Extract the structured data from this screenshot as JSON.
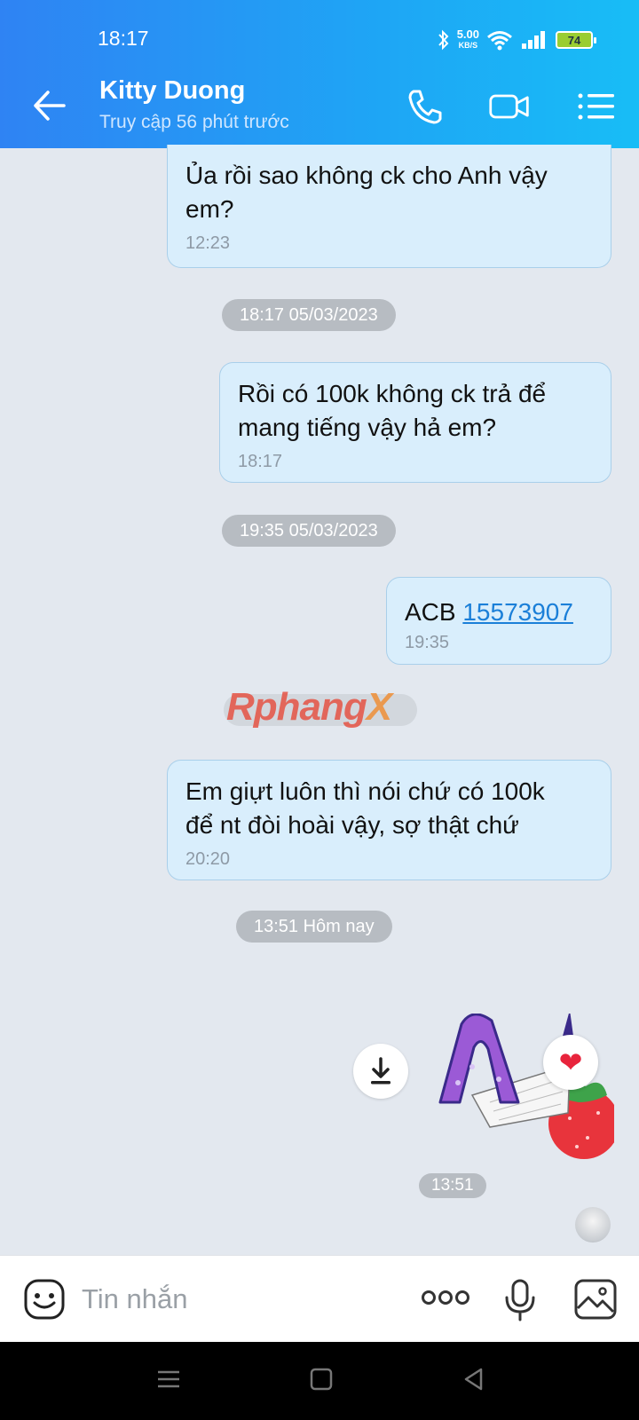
{
  "status_bar": {
    "time": "18:17",
    "net_speed": "5.00",
    "net_unit": "KB/S",
    "battery": "74"
  },
  "header": {
    "title": "Kitty Duong",
    "subtitle": "Truy cập 56 phút trước"
  },
  "messages": [
    {
      "text": "Ủa rồi sao không ck cho Anh vậy\nem?",
      "time": "12:23"
    },
    {
      "date": "18:17 05/03/2023"
    },
    {
      "text": "Rồi có 100k không ck trả để\nmang tiếng vậy hả em?",
      "time": "18:17"
    },
    {
      "date": "19:35 05/03/2023"
    },
    {
      "prefix": "ACB ",
      "link": "15573907",
      "time": "19:35"
    },
    {
      "text": "Em giựt luôn thì nói chứ có 100k\nđể nt đòi hoài vậy, sợ thật chứ",
      "time": "20:20"
    },
    {
      "date": "13:51 Hôm nay"
    },
    {
      "sticker_time": "13:51"
    }
  ],
  "watermark": {
    "part1": "Rphang",
    "part2": "X"
  },
  "input": {
    "placeholder": "Tin nhắn"
  },
  "icons": {
    "back": "arrow-left-icon",
    "call": "phone-icon",
    "video": "video-camera-icon",
    "menu": "list-menu-icon",
    "download": "download-icon",
    "reaction": "heart-icon",
    "emoji": "emoji-face-icon",
    "more": "more-dots-icon",
    "mic": "microphone-icon",
    "image": "image-icon"
  },
  "colors": {
    "header_start": "#2f83f3",
    "header_end": "#18bdf6",
    "bubble": "#d9eefc",
    "link": "#1b7fd8",
    "reaction": "#e8243c"
  }
}
